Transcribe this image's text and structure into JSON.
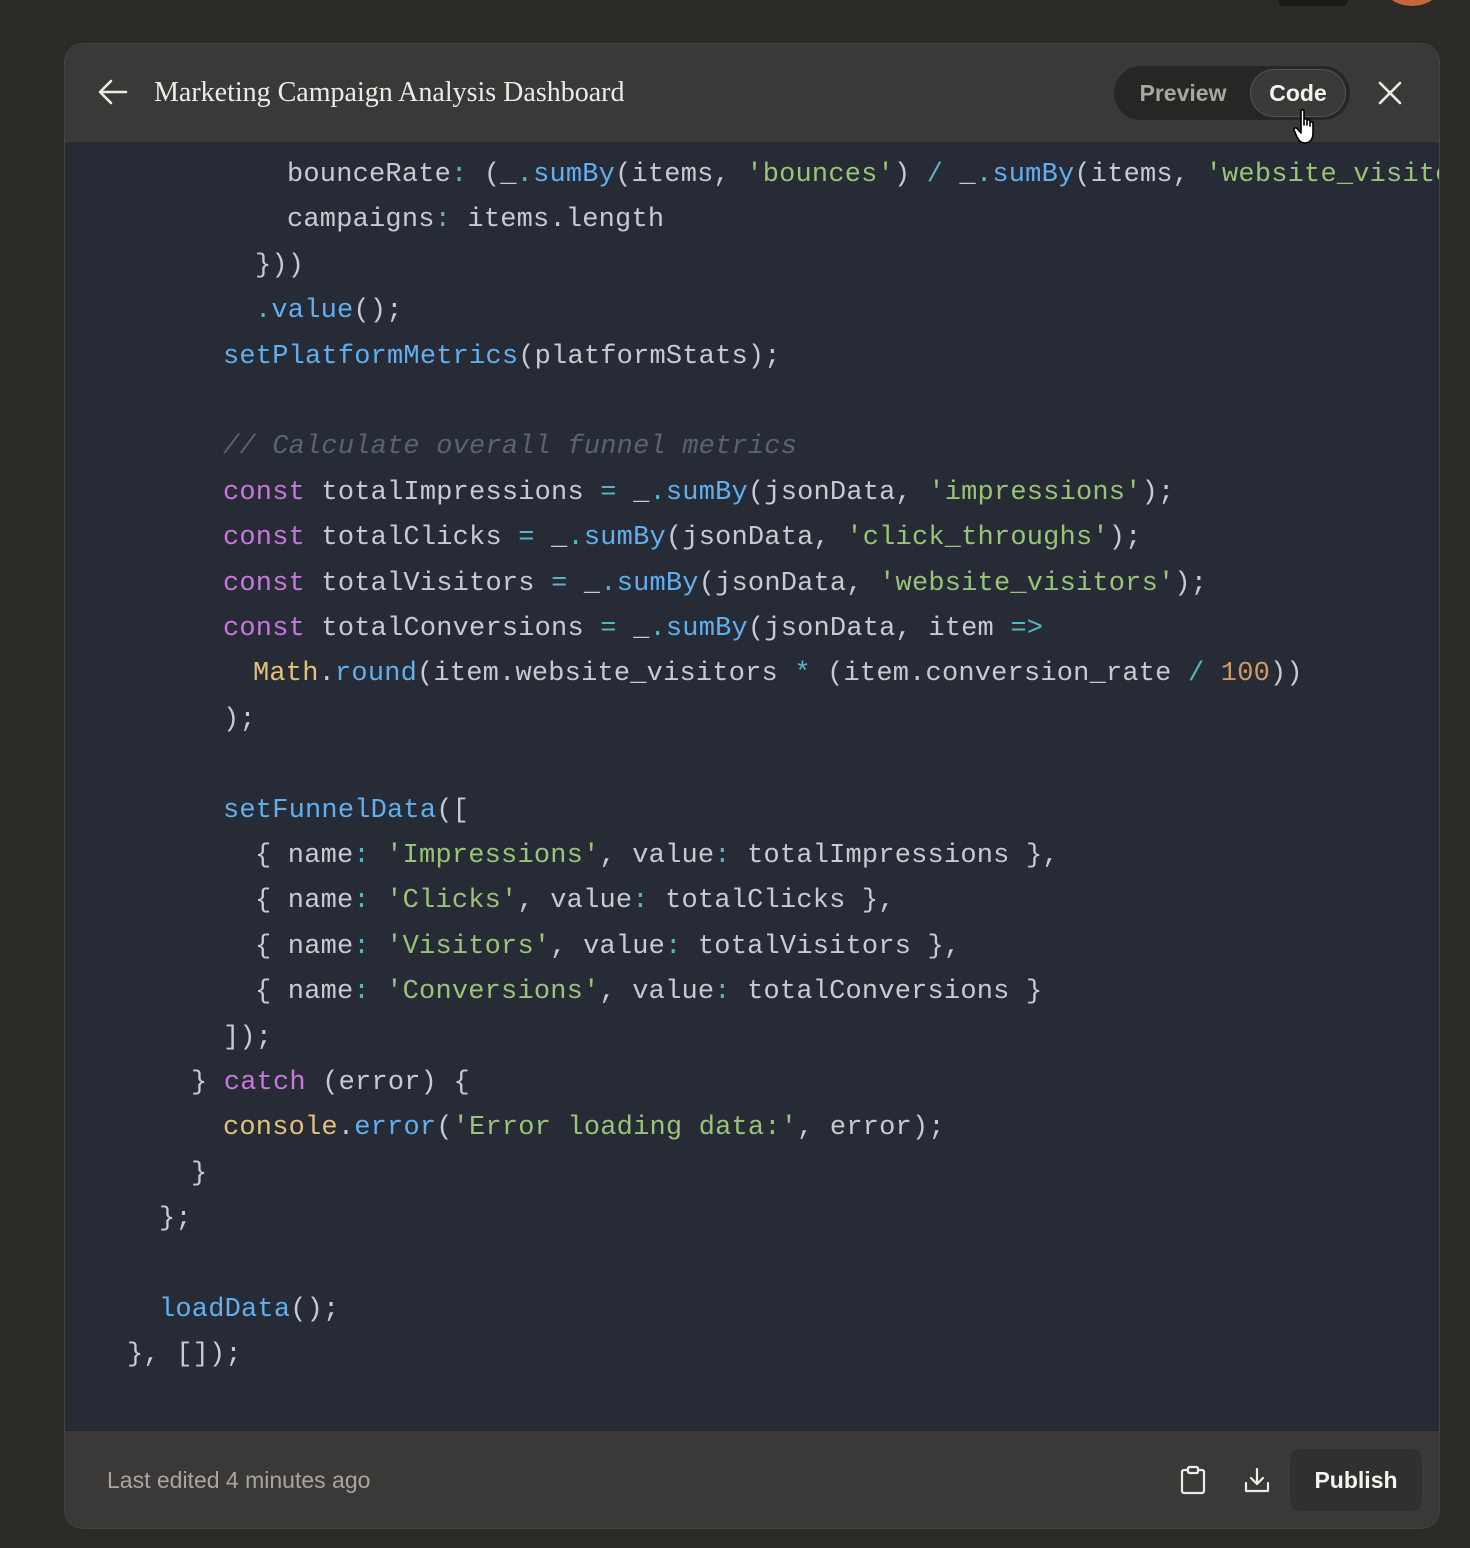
{
  "window": {
    "title": "Marketing Campaign Analysis Dashboard",
    "back_icon": "arrow-left-icon",
    "close_icon": "close-icon"
  },
  "view_toggle": {
    "options": [
      "Preview",
      "Code"
    ],
    "selected": "Code"
  },
  "footer": {
    "last_edited": "Last edited 4 minutes ago",
    "copy_icon": "clipboard-icon",
    "download_icon": "download-icon",
    "publish_label": "Publish"
  },
  "colors": {
    "panel_bg": "#3a3937",
    "code_bg": "#272b35",
    "keyword": "#c678dd",
    "function": "#61afef",
    "string": "#98c379",
    "number": "#d19a66",
    "object": "#e5c07b",
    "operator": "#56b6c2",
    "comment": "#5c6370",
    "text": "#c6cad3"
  },
  "code": {
    "lines": [
      [
        [
          "txt",
          "bounceRate"
        ],
        [
          "op",
          ":"
        ],
        [
          "txt",
          " (_"
        ],
        [
          "op",
          "."
        ],
        [
          "fn",
          "sumBy"
        ],
        [
          "txt",
          "(items, "
        ],
        [
          "str",
          "'bounces'"
        ],
        [
          "txt",
          ") "
        ],
        [
          "op",
          "/"
        ],
        [
          "txt",
          " _"
        ],
        [
          "op",
          "."
        ],
        [
          "fn",
          "sumBy"
        ],
        [
          "txt",
          "(items, "
        ],
        [
          "str",
          "'website_visitor"
        ]
      ],
      [
        [
          "txt",
          "campaigns"
        ],
        [
          "op",
          ":"
        ],
        [
          "txt",
          " items.length"
        ]
      ],
      [
        [
          "txt",
          "}))"
        ]
      ],
      [
        [
          "op",
          "."
        ],
        [
          "fn",
          "value"
        ],
        [
          "txt",
          "();"
        ]
      ],
      [
        [
          "fn",
          "setPlatformMetrics"
        ],
        [
          "txt",
          "(platformStats);"
        ]
      ],
      [],
      [
        [
          "cm",
          "// Calculate overall funnel metrics"
        ]
      ],
      [
        [
          "kw",
          "const"
        ],
        [
          "txt",
          " totalImpressions "
        ],
        [
          "op",
          "="
        ],
        [
          "txt",
          " _"
        ],
        [
          "op",
          "."
        ],
        [
          "fn",
          "sumBy"
        ],
        [
          "txt",
          "(jsonData, "
        ],
        [
          "str",
          "'impressions'"
        ],
        [
          "txt",
          ");"
        ]
      ],
      [
        [
          "kw",
          "const"
        ],
        [
          "txt",
          " totalClicks "
        ],
        [
          "op",
          "="
        ],
        [
          "txt",
          " _"
        ],
        [
          "op",
          "."
        ],
        [
          "fn",
          "sumBy"
        ],
        [
          "txt",
          "(jsonData, "
        ],
        [
          "str",
          "'click_throughs'"
        ],
        [
          "txt",
          ");"
        ]
      ],
      [
        [
          "kw",
          "const"
        ],
        [
          "txt",
          " totalVisitors "
        ],
        [
          "op",
          "="
        ],
        [
          "txt",
          " _"
        ],
        [
          "op",
          "."
        ],
        [
          "fn",
          "sumBy"
        ],
        [
          "txt",
          "(jsonData, "
        ],
        [
          "str",
          "'website_visitors'"
        ],
        [
          "txt",
          ");"
        ]
      ],
      [
        [
          "kw",
          "const"
        ],
        [
          "txt",
          " totalConversions "
        ],
        [
          "op",
          "="
        ],
        [
          "txt",
          " _"
        ],
        [
          "op",
          "."
        ],
        [
          "fn",
          "sumBy"
        ],
        [
          "txt",
          "(jsonData, item "
        ],
        [
          "op",
          "=>"
        ]
      ],
      [
        [
          "obj",
          "Math"
        ],
        [
          "txt",
          "."
        ],
        [
          "fn",
          "round"
        ],
        [
          "txt",
          "(item.website_visitors "
        ],
        [
          "op",
          "*"
        ],
        [
          "txt",
          " (item.conversion_rate "
        ],
        [
          "op",
          "/"
        ],
        [
          "txt",
          " "
        ],
        [
          "num",
          "100"
        ],
        [
          "txt",
          "))"
        ]
      ],
      [
        [
          "txt",
          ");"
        ]
      ],
      [],
      [
        [
          "fn",
          "setFunnelData"
        ],
        [
          "txt",
          "(["
        ]
      ],
      [
        [
          "txt",
          "{ name"
        ],
        [
          "op",
          ":"
        ],
        [
          "txt",
          " "
        ],
        [
          "str",
          "'Impressions'"
        ],
        [
          "txt",
          ", value"
        ],
        [
          "op",
          ":"
        ],
        [
          "txt",
          " totalImpressions },"
        ]
      ],
      [
        [
          "txt",
          "{ name"
        ],
        [
          "op",
          ":"
        ],
        [
          "txt",
          " "
        ],
        [
          "str",
          "'Clicks'"
        ],
        [
          "txt",
          ", value"
        ],
        [
          "op",
          ":"
        ],
        [
          "txt",
          " totalClicks },"
        ]
      ],
      [
        [
          "txt",
          "{ name"
        ],
        [
          "op",
          ":"
        ],
        [
          "txt",
          " "
        ],
        [
          "str",
          "'Visitors'"
        ],
        [
          "txt",
          ", value"
        ],
        [
          "op",
          ":"
        ],
        [
          "txt",
          " totalVisitors },"
        ]
      ],
      [
        [
          "txt",
          "{ name"
        ],
        [
          "op",
          ":"
        ],
        [
          "txt",
          " "
        ],
        [
          "str",
          "'Conversions'"
        ],
        [
          "txt",
          ", value"
        ],
        [
          "op",
          ":"
        ],
        [
          "txt",
          " totalConversions }"
        ]
      ],
      [
        [
          "txt",
          "]);"
        ]
      ],
      [
        [
          "txt",
          "} "
        ],
        [
          "kw",
          "catch"
        ],
        [
          "txt",
          " (error) {"
        ]
      ],
      [
        [
          "obj",
          "console"
        ],
        [
          "txt",
          "."
        ],
        [
          "fn",
          "error"
        ],
        [
          "txt",
          "("
        ],
        [
          "str",
          "'Error loading data:'"
        ],
        [
          "txt",
          ", error);"
        ]
      ],
      [
        [
          "txt",
          "}"
        ]
      ],
      [
        [
          "txt",
          "};"
        ]
      ],
      [],
      [
        [
          "fn",
          "loadData"
        ],
        [
          "txt",
          "();"
        ]
      ],
      [
        [
          "txt",
          "}, []);"
        ]
      ]
    ]
  }
}
